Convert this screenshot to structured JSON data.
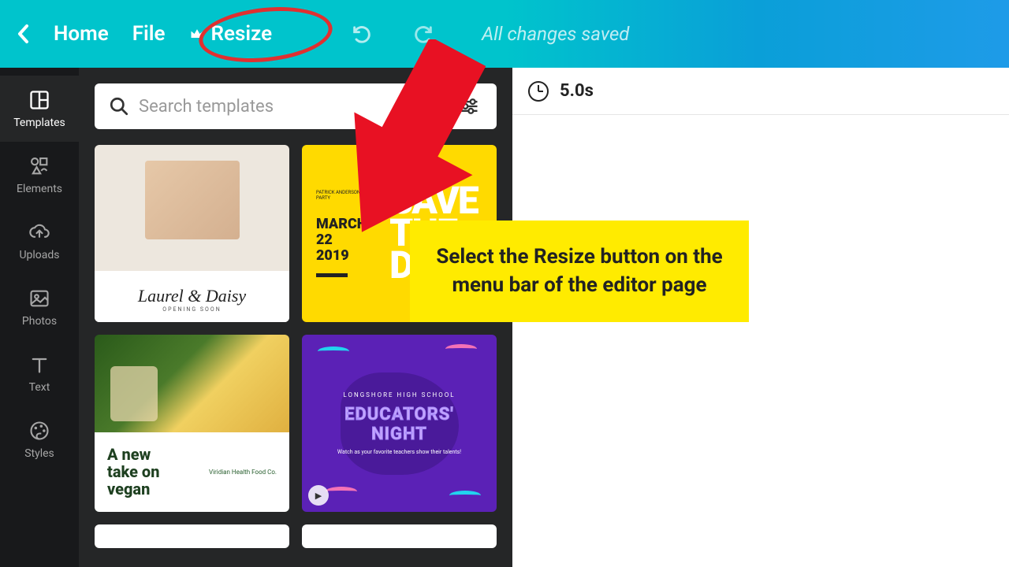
{
  "topbar": {
    "home": "Home",
    "file": "File",
    "resize": "Resize",
    "saved": "All changes saved"
  },
  "sidebar": {
    "items": [
      {
        "label": "Templates"
      },
      {
        "label": "Elements"
      },
      {
        "label": "Uploads"
      },
      {
        "label": "Photos"
      },
      {
        "label": "Text"
      },
      {
        "label": "Styles"
      }
    ]
  },
  "search": {
    "placeholder": "Search templates"
  },
  "canvas": {
    "duration": "5.0s"
  },
  "templates": {
    "t1": {
      "title": "Laurel & Daisy",
      "sub": "OPENING SOON"
    },
    "t2": {
      "tiny": "PATRICK ANDERSON'S BACHELOR PARTY",
      "dateMonth": "MARCH",
      "dateDay": "22",
      "dateYear": "2019",
      "big1": "SAVE",
      "big2": "THE",
      "big3": "DA"
    },
    "t3": {
      "line1": "A new",
      "line2": "take on",
      "line3": "vegan",
      "brand": "Viridian Health Food Co."
    },
    "t4": {
      "top": "LONGSHORE HIGH SCHOOL",
      "title1": "EDUCATORS'",
      "title2": "NIGHT",
      "sub": "Watch as your favorite teachers show their talents!"
    }
  },
  "annotation": {
    "text": "Select the Resize button on the menu bar of the editor page"
  }
}
